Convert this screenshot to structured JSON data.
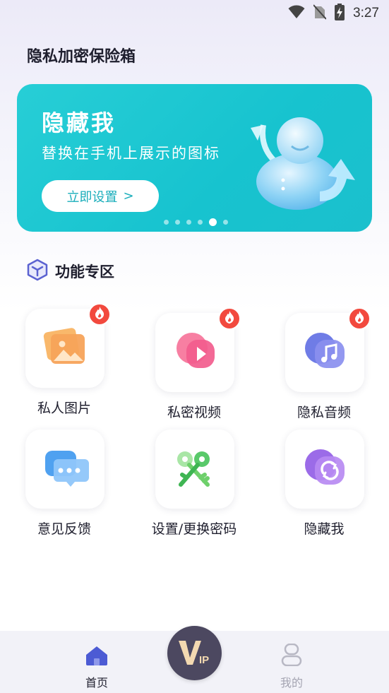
{
  "status_bar": {
    "time": "3:27"
  },
  "header": {
    "title": "隐私加密保险箱"
  },
  "banner": {
    "title": "隐藏我",
    "subtitle": "替换在手机上展示的图标",
    "button_label": "立即设置",
    "button_arrow": ">",
    "dots_total": 6,
    "active_dot_index": 4
  },
  "section": {
    "title": "功能专区"
  },
  "features": [
    {
      "label": "私人图片",
      "icon": "picture-icon",
      "hot": true
    },
    {
      "label": "私密视频",
      "icon": "video-play-icon",
      "hot": true
    },
    {
      "label": "隐私音频",
      "icon": "music-note-icon",
      "hot": true
    },
    {
      "label": "意见反馈",
      "icon": "chat-bubble-icon",
      "hot": false
    },
    {
      "label": "设置/更换密码",
      "icon": "keys-icon",
      "hot": false
    },
    {
      "label": "隐藏我",
      "icon": "swap-icon",
      "hot": false
    }
  ],
  "bottom_nav": {
    "home_label": "首页",
    "vip_label": "VIP",
    "mine_label": "我的",
    "active": "home"
  },
  "colors": {
    "accent_teal": "#17C3CF",
    "hot_red": "#F2493E",
    "nav_active": "#4C5BD4",
    "nav_inactive": "#B8B8C4"
  }
}
